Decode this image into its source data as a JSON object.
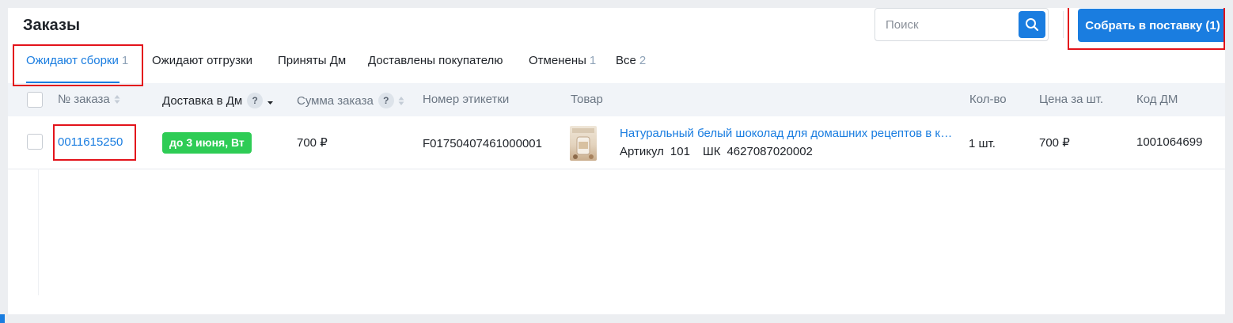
{
  "page": {
    "title": "Заказы"
  },
  "search": {
    "placeholder": "Поиск"
  },
  "toolbar": {
    "collect_label": "Собрать в поставку (1)"
  },
  "tabs": [
    {
      "label": "Ожидают сборки",
      "count": "1",
      "active": true
    },
    {
      "label": "Ожидают отгрузки",
      "count": ""
    },
    {
      "label": "Приняты Дм",
      "count": ""
    },
    {
      "label": "Доставлены покупателю",
      "count": ""
    },
    {
      "label": "Отменены",
      "count": "1"
    },
    {
      "label": "Все",
      "count": "2"
    }
  ],
  "table": {
    "headers": {
      "order": "№ заказа",
      "delivery": "Доставка в Дм",
      "sum": "Сумма заказа",
      "label": "Номер этикетки",
      "product": "Товар",
      "qty": "Кол-во",
      "price": "Цена за шт.",
      "code": "Код ДМ"
    },
    "rows": [
      {
        "order_number": "0011615250",
        "delivery": "до 3 июня, Вт",
        "sum": "700 ₽",
        "label_number": "F01750407461000001",
        "product_name": "Натуральный белый шоколад для домашних рецептов в капсулах",
        "article_label": "Артикул",
        "article": "101",
        "barcode_label": "ШК",
        "barcode": "4627087020002",
        "qty": "1 шт.",
        "price": "700 ₽",
        "code": "1001064699"
      }
    ]
  },
  "colors": {
    "accent": "#1a7de0",
    "success": "#2ecc55",
    "highlight": "#e3131b"
  }
}
